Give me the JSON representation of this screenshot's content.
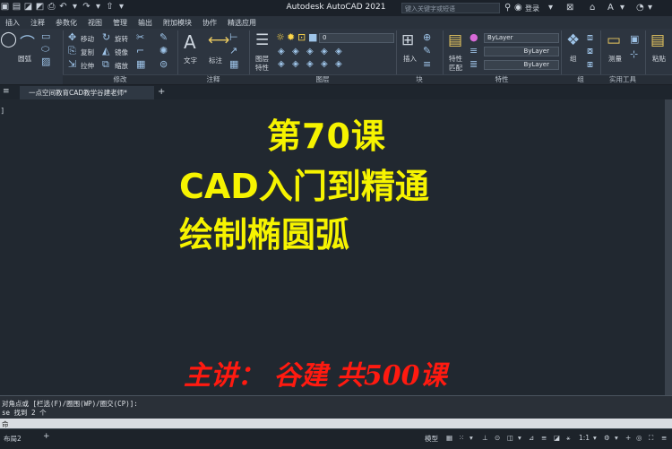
{
  "titlebar": {
    "app_title": "Autodesk AutoCAD 2021",
    "search_placeholder": "键入关键字或短语",
    "login_label": "登录"
  },
  "ribbon_tabs": [
    "插入",
    "注释",
    "参数化",
    "视图",
    "管理",
    "输出",
    "附加模块",
    "协作",
    "精选应用"
  ],
  "ribbon": {
    "draw_arc_label": "圆弧",
    "modify": {
      "move": "移动",
      "rotate": "旋转",
      "copy": "复制",
      "mirror": "镜像",
      "stretch": "拉伸",
      "scale": "缩放",
      "panel_label": "修改"
    },
    "annotation": {
      "text": "文字",
      "dimension": "标注",
      "panel_label": "注释"
    },
    "layers": {
      "layer_props": "图层",
      "layer_props2": "特性",
      "layer_value": "0",
      "panel_label": "图层"
    },
    "block": {
      "insert": "插入",
      "panel_label": "块"
    },
    "properties": {
      "match": "特性",
      "match2": "匹配",
      "color": "ByLayer",
      "linetype": "ByLayer",
      "lineweight": "ByLayer",
      "panel_label": "特性"
    },
    "groups": {
      "group": "组",
      "panel_label": "组"
    },
    "utilities": {
      "measure": "测量",
      "panel_label": "实用工具"
    },
    "clipboard": {
      "paste": "粘贴"
    }
  },
  "doc_tab": {
    "title": "一点空间教育CAD教学谷建老师*"
  },
  "canvas": {
    "left_marker": "]",
    "line1": "第70课",
    "line2": "CAD入门到精通",
    "line3": "绘制椭圆弧",
    "footer": "主讲：  谷建      共500课"
  },
  "command": {
    "line1": "对角点或 [栏选(F)/圈围(WP)/圈交(CP)]:",
    "line2": "se 找到 2 个",
    "prompt": "命"
  },
  "status": {
    "layout_tab": "布局2",
    "model_label": "模型",
    "scale_label": "1:1"
  },
  "colors": {
    "title_yellow": "#f6f300",
    "footer_red": "#ff1a10",
    "bg": "#212830"
  }
}
